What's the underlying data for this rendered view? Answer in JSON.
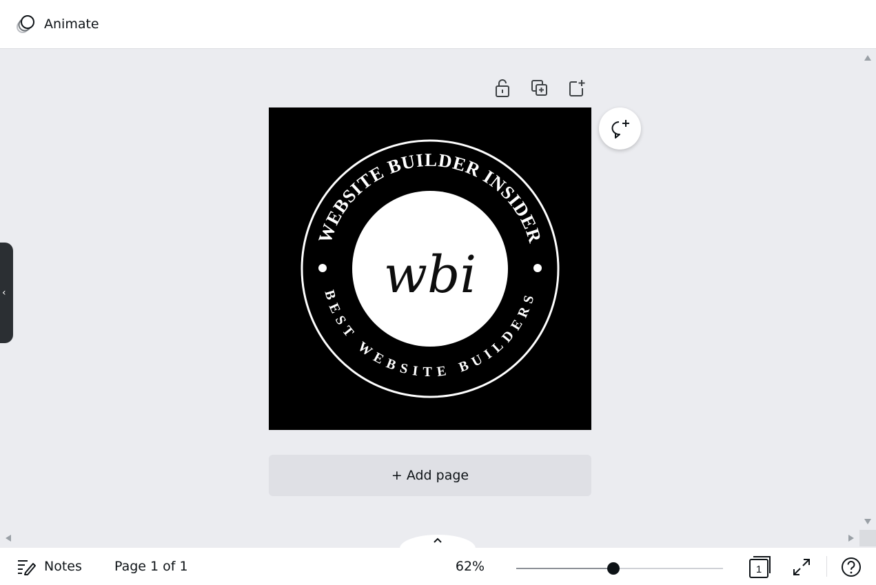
{
  "header": {
    "animate_label": "Animate"
  },
  "toolbar": {
    "icons": [
      "lock-icon",
      "duplicate-page-icon",
      "add-page-icon"
    ]
  },
  "artboard": {
    "top_arc_text": "WEBSITE BUILDER INSIDER",
    "bottom_arc_text": "BEST WEBSITE BUILDERS",
    "monogram": "wbi",
    "background_color": "#000000",
    "ring_color": "#ffffff"
  },
  "add_page": {
    "label": "+ Add page"
  },
  "footer": {
    "notes_label": "Notes",
    "page_count": "Page 1 of 1",
    "zoom_level": "62%",
    "zoom_fraction": 0.47,
    "page_number": "1"
  },
  "colors": {
    "canvas_bg": "#ebecf0",
    "panel_bg": "#ffffff",
    "text": "#0d1216"
  }
}
